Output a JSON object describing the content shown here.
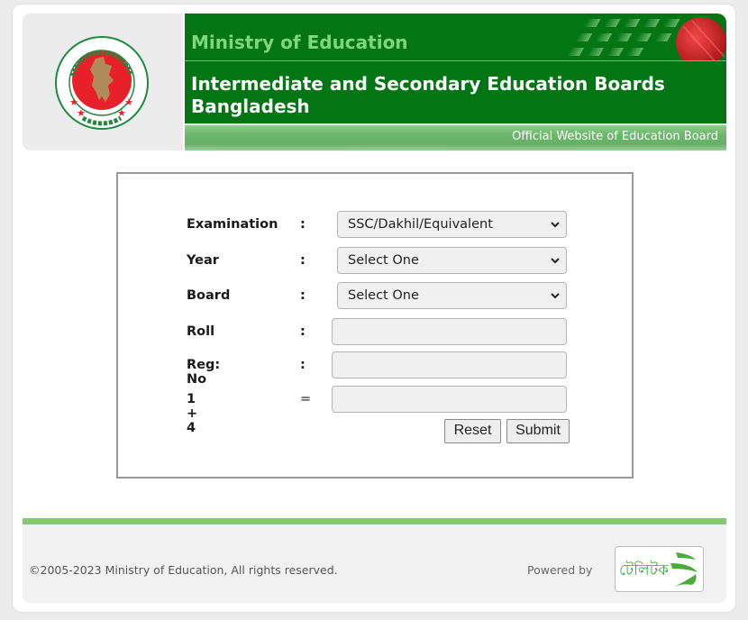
{
  "header": {
    "ministry": "Ministry of Education",
    "title": "Intermediate and Secondary Education Boards Bangladesh",
    "tagline": "Official Website of Education Board",
    "logo_icon": "government-seal-icon",
    "flag_icon": "bangladesh-flag-icon"
  },
  "form": {
    "examination": {
      "label": "Examination",
      "sep": ":",
      "value": "SSC/Dakhil/Equivalent"
    },
    "year": {
      "label": "Year",
      "sep": ":",
      "value": "Select One"
    },
    "board": {
      "label": "Board",
      "sep": ":",
      "value": "Select One"
    },
    "roll": {
      "label": "Roll",
      "sep": ":",
      "value": ""
    },
    "reg_no": {
      "label": "Reg: No",
      "sep": ":",
      "value": ""
    },
    "captcha": {
      "label": "1 + 4",
      "sep": "=",
      "value": ""
    },
    "reset_label": "Reset",
    "submit_label": "Submit"
  },
  "footer": {
    "copyright": "©2005-2023 Ministry of Education, All rights reserved.",
    "powered_by": "Powered by",
    "sponsor_logo_text": "টেলিটক"
  },
  "colors": {
    "banner_green": "#037515",
    "ministry_text": "#7ed67e",
    "footer_bar": "#86c872",
    "seal_red": "#e8202a"
  }
}
